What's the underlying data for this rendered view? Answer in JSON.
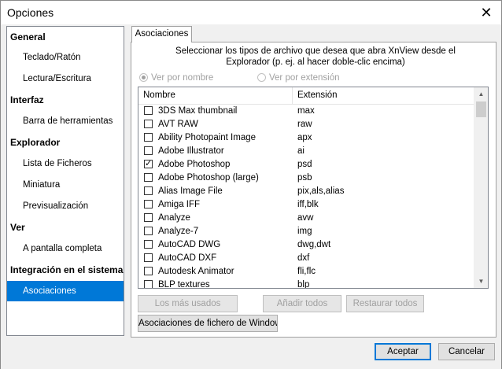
{
  "window": {
    "title": "Opciones",
    "close_glyph": "✕"
  },
  "nav": {
    "items": [
      {
        "label": "General",
        "type": "cat"
      },
      {
        "label": "Teclado/Ratón",
        "type": "sub"
      },
      {
        "label": "Lectura/Escritura",
        "type": "sub"
      },
      {
        "label": "Interfaz",
        "type": "cat"
      },
      {
        "label": "Barra de herramientas",
        "type": "sub"
      },
      {
        "label": "Explorador",
        "type": "cat"
      },
      {
        "label": "Lista de Ficheros",
        "type": "sub"
      },
      {
        "label": "Miniatura",
        "type": "sub"
      },
      {
        "label": "Previsualización",
        "type": "sub"
      },
      {
        "label": "Ver",
        "type": "cat"
      },
      {
        "label": "A pantalla completa",
        "type": "sub"
      },
      {
        "label": "Integración en el sistema",
        "type": "cat"
      },
      {
        "label": "Asociaciones",
        "type": "sub",
        "selected": true
      }
    ]
  },
  "tab": {
    "label": "Asociaciones"
  },
  "description": {
    "line1": "Seleccionar los tipos de archivo que desea que abra XnView desde el",
    "line2": "Explorador (p. ej. al hacer doble-clic encima)"
  },
  "view_options": {
    "by_name": "Ver por nombre",
    "by_extension": "Ver por extensión",
    "selected": "by_name"
  },
  "file_list": {
    "columns": {
      "name": "Nombre",
      "extension": "Extensión"
    },
    "rows": [
      {
        "name": "3DS Max thumbnail",
        "ext": "max",
        "checked": false
      },
      {
        "name": "AVT RAW",
        "ext": "raw",
        "checked": false
      },
      {
        "name": "Ability Photopaint Image",
        "ext": "apx",
        "checked": false
      },
      {
        "name": "Adobe Illustrator",
        "ext": "ai",
        "checked": false
      },
      {
        "name": "Adobe Photoshop",
        "ext": "psd",
        "checked": true
      },
      {
        "name": "Adobe Photoshop (large)",
        "ext": "psb",
        "checked": false
      },
      {
        "name": "Alias Image File",
        "ext": "pix,als,alias",
        "checked": false
      },
      {
        "name": "Amiga IFF",
        "ext": "iff,blk",
        "checked": false
      },
      {
        "name": "Analyze",
        "ext": "avw",
        "checked": false
      },
      {
        "name": "Analyze-7",
        "ext": "img",
        "checked": false
      },
      {
        "name": "AutoCAD DWG",
        "ext": "dwg,dwt",
        "checked": false
      },
      {
        "name": "AutoCAD DXF",
        "ext": "dxf",
        "checked": false
      },
      {
        "name": "Autodesk Animator",
        "ext": "fli,flc",
        "checked": false
      },
      {
        "name": "BLP textures",
        "ext": "blp",
        "checked": false
      }
    ]
  },
  "buttons": {
    "most_used": "Los más usados",
    "add_all": "Añadir todos",
    "restore_all": "Restaurar todos",
    "windows_assoc": "Asociaciones de fichero de Windows...",
    "accept": "Aceptar",
    "cancel": "Cancelar"
  }
}
